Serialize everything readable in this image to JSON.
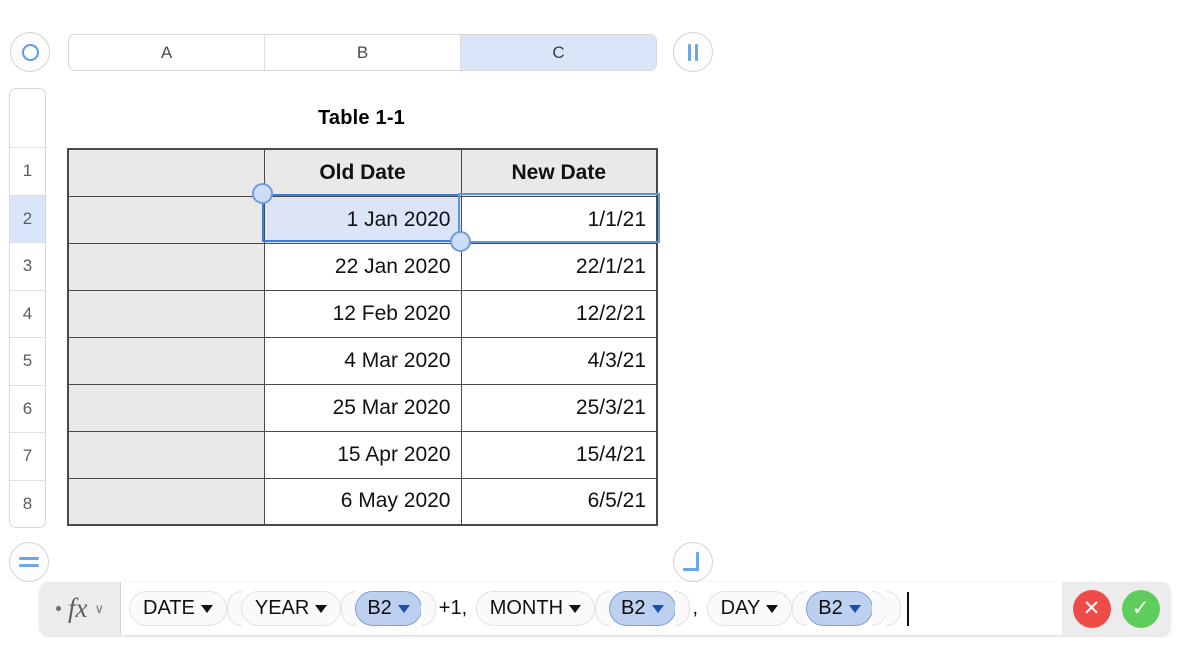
{
  "toolbar": {
    "circle_icon": "circle-outline-icon",
    "pause_icon": "column-divider-icon",
    "equals_icon": "equals-icon",
    "corner_icon": "corner-resize-icon"
  },
  "columns": [
    {
      "label": "A",
      "selected": false
    },
    {
      "label": "B",
      "selected": false
    },
    {
      "label": "C",
      "selected": true
    }
  ],
  "rows": [
    {
      "label": "",
      "selected": false
    },
    {
      "label": "1",
      "selected": false
    },
    {
      "label": "2",
      "selected": true
    },
    {
      "label": "3",
      "selected": false
    },
    {
      "label": "4",
      "selected": false
    },
    {
      "label": "5",
      "selected": false
    },
    {
      "label": "6",
      "selected": false
    },
    {
      "label": "7",
      "selected": false
    },
    {
      "label": "8",
      "selected": false
    }
  ],
  "table": {
    "title": "Table 1-1",
    "headers": [
      "",
      "Old Date",
      "New Date"
    ],
    "rows": [
      {
        "a": "",
        "b": "1 Jan 2020",
        "c": "1/1/21",
        "b_selected": true
      },
      {
        "a": "",
        "b": "22 Jan 2020",
        "c": "22/1/21",
        "b_selected": false
      },
      {
        "a": "",
        "b": "12 Feb 2020",
        "c": "12/2/21",
        "b_selected": false
      },
      {
        "a": "",
        "b": "4 Mar 2020",
        "c": "4/3/21",
        "b_selected": false
      },
      {
        "a": "",
        "b": "25 Mar 2020",
        "c": "25/3/21",
        "b_selected": false
      },
      {
        "a": "",
        "b": "15 Apr 2020",
        "c": "15/4/21",
        "b_selected": false
      },
      {
        "a": "",
        "b": "6 May 2020",
        "c": "6/5/21",
        "b_selected": false
      }
    ]
  },
  "formula_bar": {
    "fx_label": "fx",
    "chevron": "∨",
    "tokens": [
      {
        "type": "fn",
        "text": "DATE"
      },
      {
        "type": "fn",
        "text": "YEAR"
      },
      {
        "type": "ref",
        "text": "B2"
      },
      {
        "type": "paren",
        "text": ")"
      },
      {
        "type": "plain",
        "text": "+1, "
      },
      {
        "type": "fn",
        "text": "MONTH"
      },
      {
        "type": "ref",
        "text": "B2"
      },
      {
        "type": "paren",
        "text": ")"
      },
      {
        "type": "plain",
        "text": ", "
      },
      {
        "type": "fn",
        "text": "DAY"
      },
      {
        "type": "ref",
        "text": "B2"
      },
      {
        "type": "paren",
        "text": ")"
      },
      {
        "type": "paren",
        "text": ")"
      }
    ],
    "cancel_label": "✕",
    "accept_label": "✓"
  },
  "colors": {
    "accent_blue": "#5b9bea",
    "selection_fill": "#d9e6fa",
    "selection_border": "#3d7dd4",
    "ref_token": "#bdd0ef",
    "cancel_red": "#ef4b49",
    "accept_green": "#5fcd5c",
    "grid_line": "#4a4a4a",
    "header_fill": "#e9e9e9"
  }
}
